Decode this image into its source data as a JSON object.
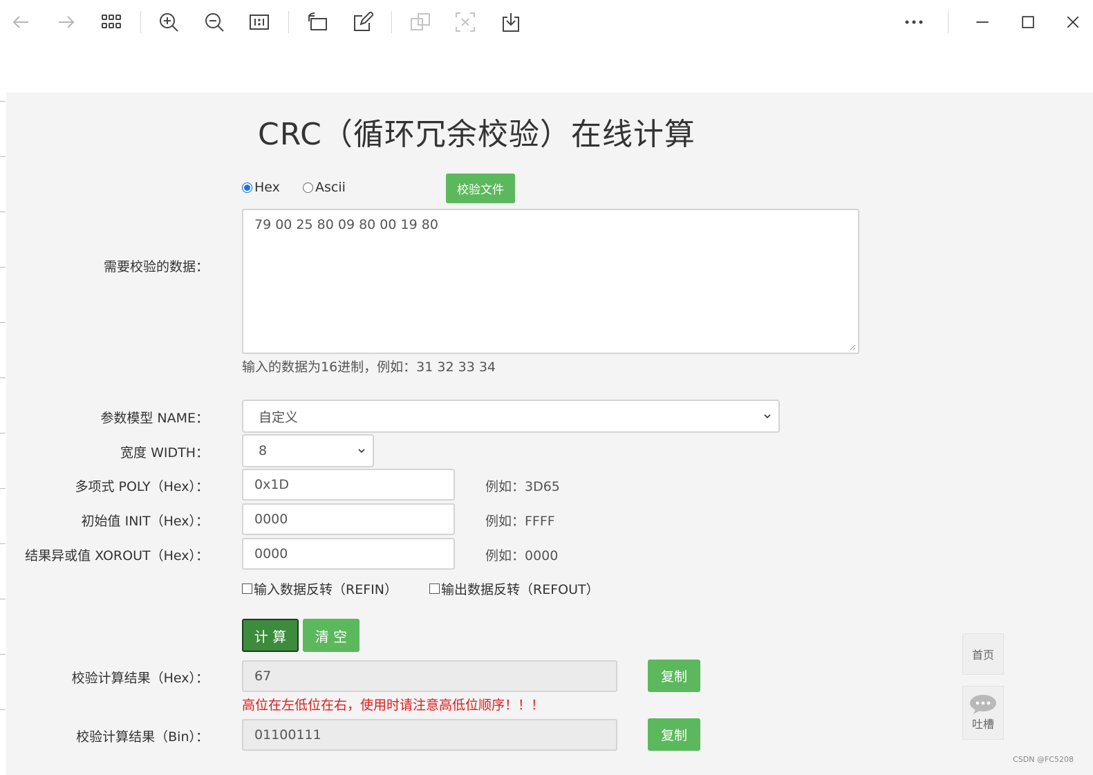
{
  "toolbar": {
    "icons": [
      "back-arrow-icon",
      "forward-arrow-icon",
      "grid-view-icon",
      "zoom-in-icon",
      "zoom-out-icon",
      "actual-size-icon",
      "rotate-icon",
      "edit-icon",
      "translate-icon",
      "extract-text-icon",
      "download-icon",
      "more-icon",
      "minimize-icon",
      "maximize-icon",
      "close-icon"
    ]
  },
  "page": {
    "title": "CRC（循环冗余校验）在线计算",
    "input_format": {
      "options": [
        "Hex",
        "Ascii"
      ],
      "selected": "Hex"
    },
    "verify_file_button": "校验文件",
    "data_label": "需要校验的数据：",
    "data_value": "79 00 25 80 09 80 00 19 80",
    "data_hint": "输入的数据为16进制，例如：31 32 33 34",
    "model": {
      "label": "参数模型 NAME：",
      "value": "自定义"
    },
    "width": {
      "label": "宽度 WIDTH：",
      "value": "8"
    },
    "poly": {
      "label": "多项式 POLY（Hex）：",
      "value": "0x1D",
      "example": "例如：3D65"
    },
    "init": {
      "label": "初始值 INIT（Hex）：",
      "value": "0000",
      "example": "例如：FFFF"
    },
    "xorout": {
      "label": "结果异或值 XOROUT（Hex）：",
      "value": "0000",
      "example": "例如：0000"
    },
    "refin": {
      "label": "输入数据反转（REFIN）",
      "checked": false
    },
    "refout": {
      "label": "输出数据反转（REFOUT）",
      "checked": false
    },
    "calc_button": "计 算",
    "clear_button": "清 空",
    "result_hex": {
      "label": "校验计算结果（Hex）：",
      "value": "67",
      "copy": "复制"
    },
    "warning": "高位在左低位在右，使用时请注意高低位顺序！！！",
    "result_bin": {
      "label": "校验计算结果（Bin）：",
      "value": "01100111",
      "copy": "复制"
    },
    "side_home": "首页",
    "side_feedback": "吐槽",
    "watermark": "CSDN @FC5208"
  },
  "colors": {
    "accent_green": "#5cb85c",
    "active_green": "#3d8b3d",
    "warning_red": "#e01b1b",
    "radio_blue": "#1a73e8"
  }
}
